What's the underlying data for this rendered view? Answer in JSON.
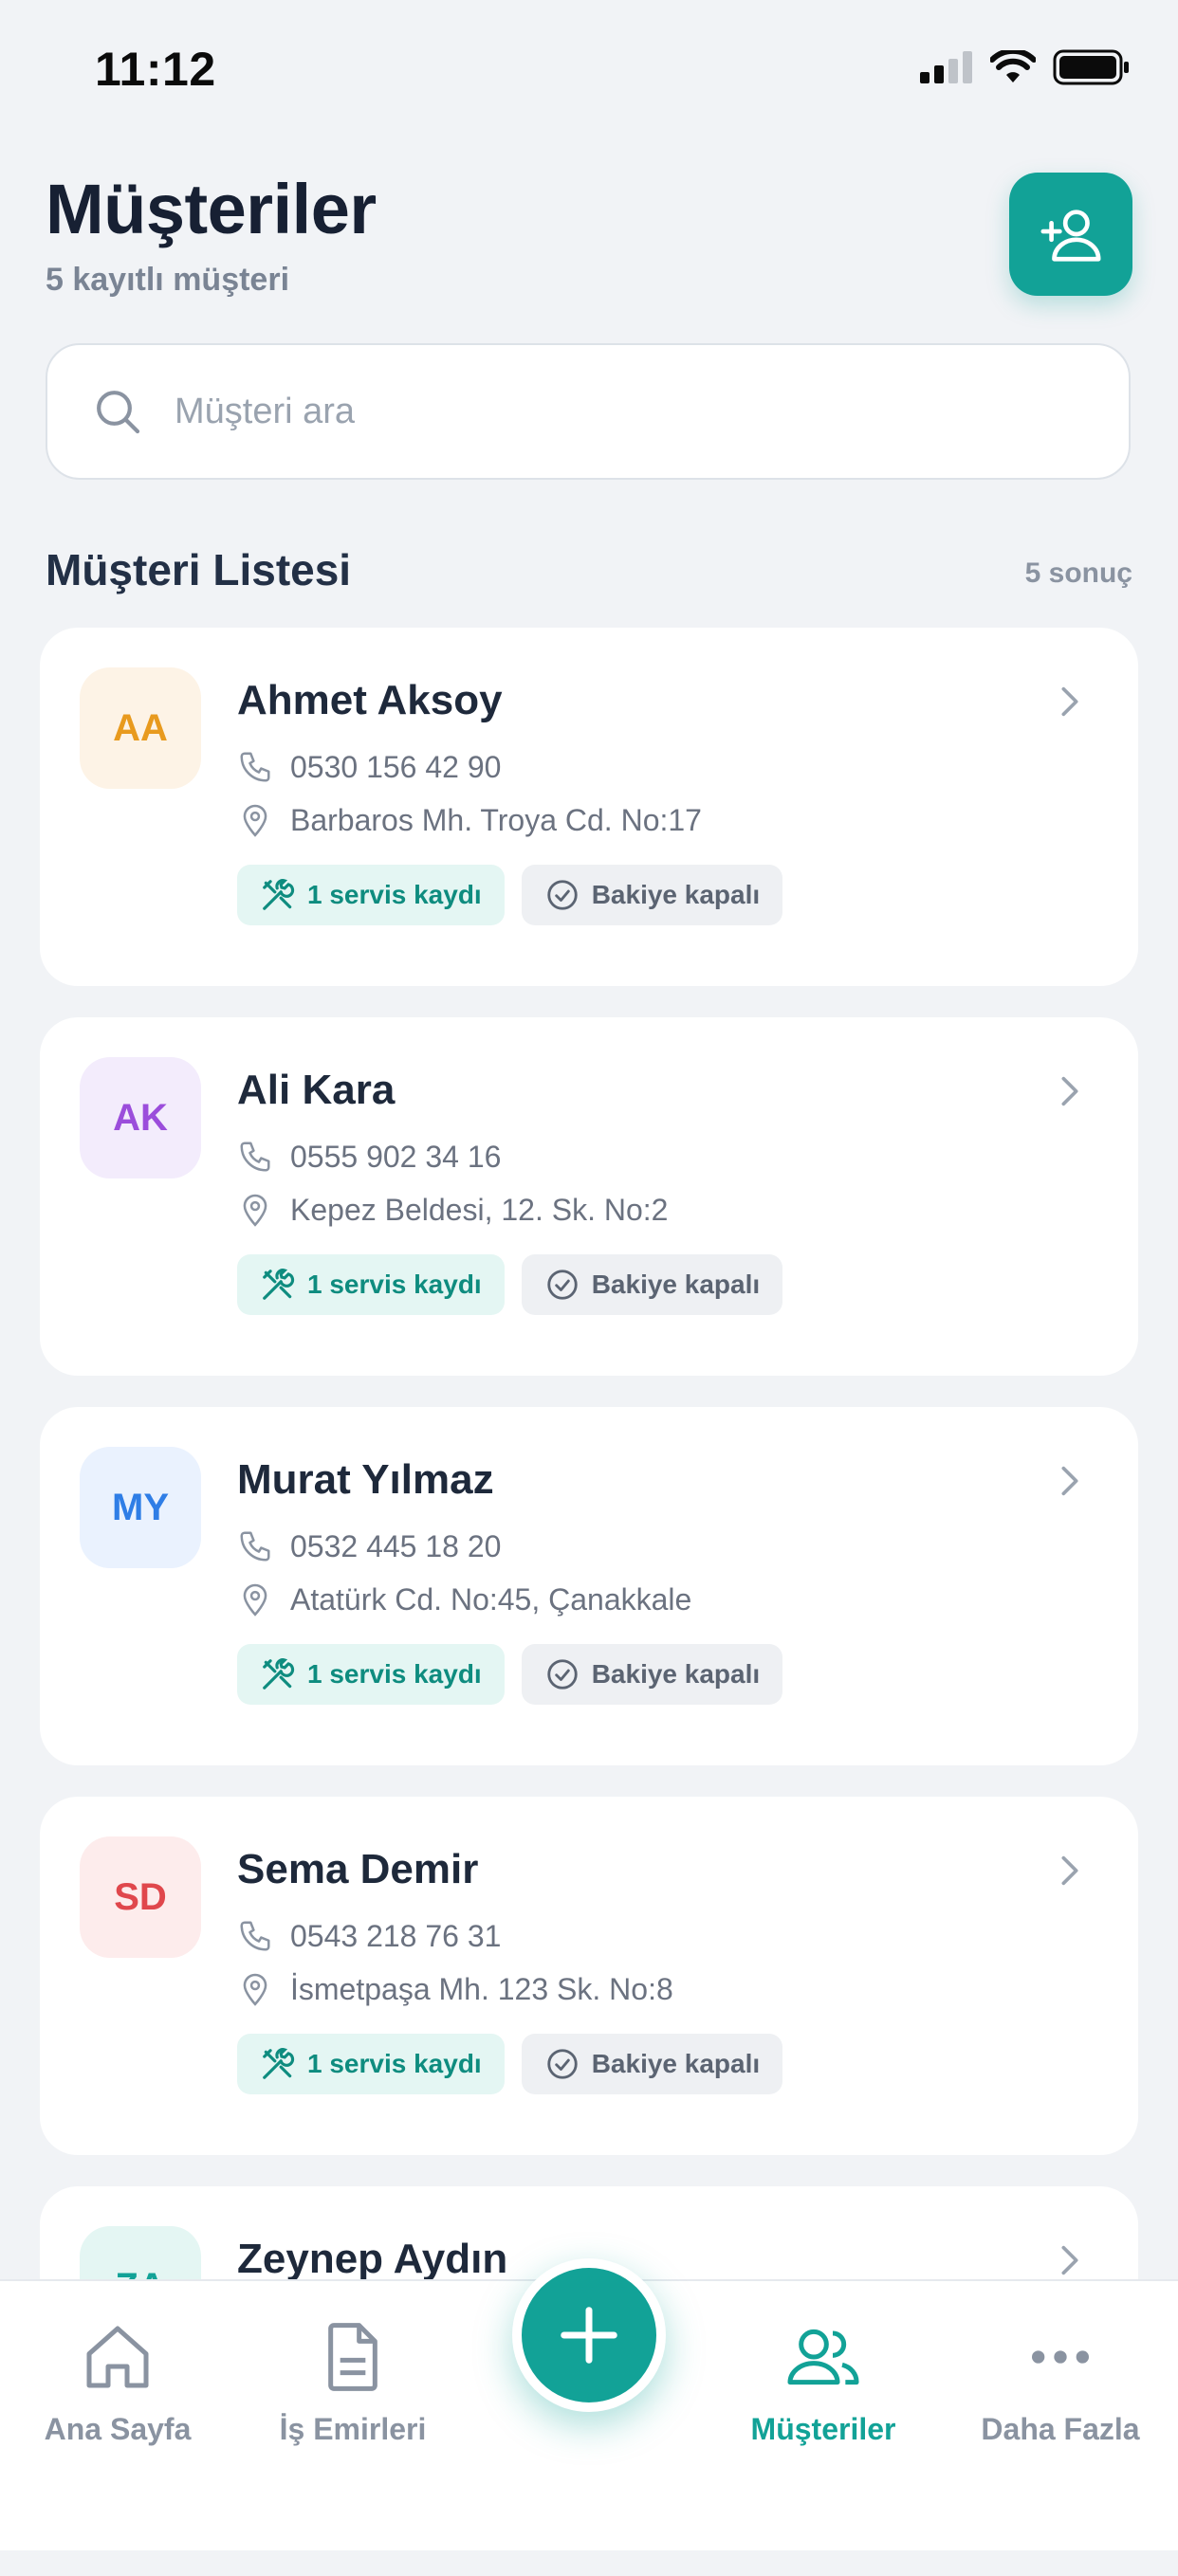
{
  "status_bar": {
    "time": "11:12"
  },
  "header": {
    "title": "Müşteriler",
    "subtitle": "5 kayıtlı müşteri",
    "add_button_icon": "user-plus-icon"
  },
  "search": {
    "placeholder": "Müşteri ara",
    "value": ""
  },
  "section": {
    "title": "Müşteri Listesi",
    "count": "5 sonuç"
  },
  "customers": [
    {
      "initials": "AA",
      "name": "Ahmet Aksoy",
      "phone": "0530 156 42 90",
      "address": "Barbaros Mh. Troya Cd. No:17",
      "service": "1 servis kaydı",
      "balance": "Bakiye kapalı",
      "color": "#E89A1E",
      "bg": "#FDF3E6"
    },
    {
      "initials": "AK",
      "name": "Ali Kara",
      "phone": "0555 902 34 16",
      "address": "Kepez Beldesi, 12. Sk. No:2",
      "service": "1 servis kaydı",
      "balance": "Bakiye kapalı",
      "color": "#9B4DDB",
      "bg": "#F3ECFC"
    },
    {
      "initials": "MY",
      "name": "Murat Yılmaz",
      "phone": "0532 445 18 20",
      "address": "Atatürk Cd. No:45, Çanakkale",
      "service": "1 servis kaydı",
      "balance": "Bakiye kapalı",
      "color": "#2F7EE6",
      "bg": "#EAF2FE"
    },
    {
      "initials": "SD",
      "name": "Sema Demir",
      "phone": "0543 218 76 31",
      "address": "İsmetpaşa Mh. 123 Sk. No:8",
      "service": "1 servis kaydı",
      "balance": "Bakiye kapalı",
      "color": "#E0474C",
      "bg": "#FDECEC"
    },
    {
      "initials": "ZA",
      "name": "Zeynep Aydın",
      "phone": "",
      "address": "",
      "service": "",
      "balance": "",
      "color": "#12A297",
      "bg": "#E4F6F3"
    }
  ],
  "nav": {
    "home": "Ana Sayfa",
    "work_orders": "İş Emirleri",
    "customers": "Müşteriler",
    "more": "Daha Fazla",
    "active": "customers"
  },
  "colors": {
    "accent": "#12A297",
    "background": "#F1F3F6"
  }
}
